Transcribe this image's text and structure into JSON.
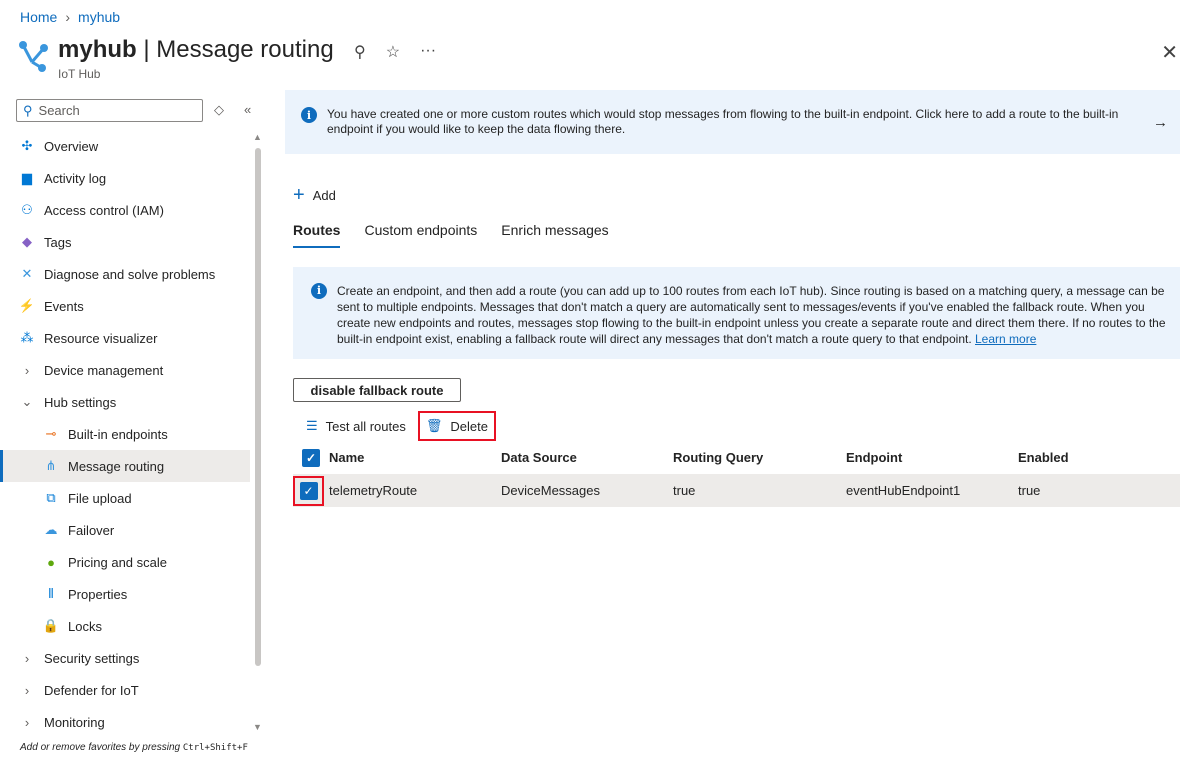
{
  "breadcrumb": [
    "Home",
    "myhub"
  ],
  "header": {
    "resource": "myhub",
    "page": "Message routing",
    "separator": "|",
    "subtitle": "IoT Hub"
  },
  "search": {
    "placeholder": "Search"
  },
  "nav": [
    {
      "label": "Overview",
      "icon": "overview-icon",
      "glyph": "✣",
      "color": "#0078d4"
    },
    {
      "label": "Activity log",
      "icon": "activity-log-icon",
      "glyph": "▆",
      "color": "#0078d4"
    },
    {
      "label": "Access control (IAM)",
      "icon": "people-icon",
      "glyph": "⚇",
      "color": "#0078d4"
    },
    {
      "label": "Tags",
      "icon": "tag-icon",
      "glyph": "◆",
      "color": "#8661c5"
    },
    {
      "label": "Diagnose and solve problems",
      "icon": "wrench-icon",
      "glyph": "✕",
      "color": "#3a96dd"
    },
    {
      "label": "Events",
      "icon": "lightning-icon",
      "glyph": "⚡",
      "color": "#f8c21a"
    },
    {
      "label": "Resource visualizer",
      "icon": "hierarchy-icon",
      "glyph": "⁂",
      "color": "#0078d4"
    },
    {
      "label": "Device management",
      "group": true
    },
    {
      "label": "Hub settings",
      "group": true,
      "expanded": true
    },
    {
      "label": "Built-in endpoints",
      "sub": true,
      "icon": "endpoint-icon",
      "glyph": "⊸",
      "color": "#e86f1c"
    },
    {
      "label": "Message routing",
      "sub": true,
      "selected": true,
      "icon": "routing-icon",
      "glyph": "⋔",
      "color": "#3a96dd"
    },
    {
      "label": "File upload",
      "sub": true,
      "icon": "file-upload-icon",
      "glyph": "⧉",
      "color": "#0078d4"
    },
    {
      "label": "Failover",
      "sub": true,
      "icon": "cloud-icon",
      "glyph": "☁",
      "color": "#3a96dd"
    },
    {
      "label": "Pricing and scale",
      "sub": true,
      "icon": "pricing-icon",
      "glyph": "●",
      "color": "#5ea80d"
    },
    {
      "label": "Properties",
      "sub": true,
      "icon": "properties-icon",
      "glyph": "⦀",
      "color": "#0078d4"
    },
    {
      "label": "Locks",
      "sub": true,
      "icon": "lock-icon",
      "glyph": "🔒",
      "color": "#3a96dd"
    },
    {
      "label": "Security settings",
      "group": true
    },
    {
      "label": "Defender for IoT",
      "group": true
    },
    {
      "label": "Monitoring",
      "group": true
    }
  ],
  "fav_hint": {
    "text": "Add or remove favorites by pressing ",
    "keys": "Ctrl+Shift+F"
  },
  "banner": {
    "text": "You have created one or more custom routes which would stop messages from flowing to the built-in endpoint.  Click here to add a route to the built-in endpoint if you would like to keep the data flowing there."
  },
  "add_label": "Add",
  "tabs": [
    "Routes",
    "Custom endpoints",
    "Enrich messages"
  ],
  "info": {
    "text": "Create an endpoint, and then add a route (you can add up to 100 routes from each IoT hub). Since routing is based on a matching query, a message can be sent to multiple endpoints. Messages that don't match a query are automatically sent to messages/events if you've enabled the fallback route. When you create new endpoints and routes, messages stop flowing to the built-in endpoint unless you create a separate route and direct them there. If no routes to the built-in endpoint exist, enabling a fallback route will direct any messages that don't match a route query to that endpoint. ",
    "link": "Learn more"
  },
  "fallback_button": "disable fallback route",
  "toolbar": {
    "test": "Test all routes",
    "delete": "Delete"
  },
  "table": {
    "columns": [
      "Name",
      "Data Source",
      "Routing Query",
      "Endpoint",
      "Enabled"
    ],
    "rows": [
      [
        "telemetryRoute",
        "DeviceMessages",
        "true",
        "eventHubEndpoint1",
        "true"
      ]
    ]
  }
}
